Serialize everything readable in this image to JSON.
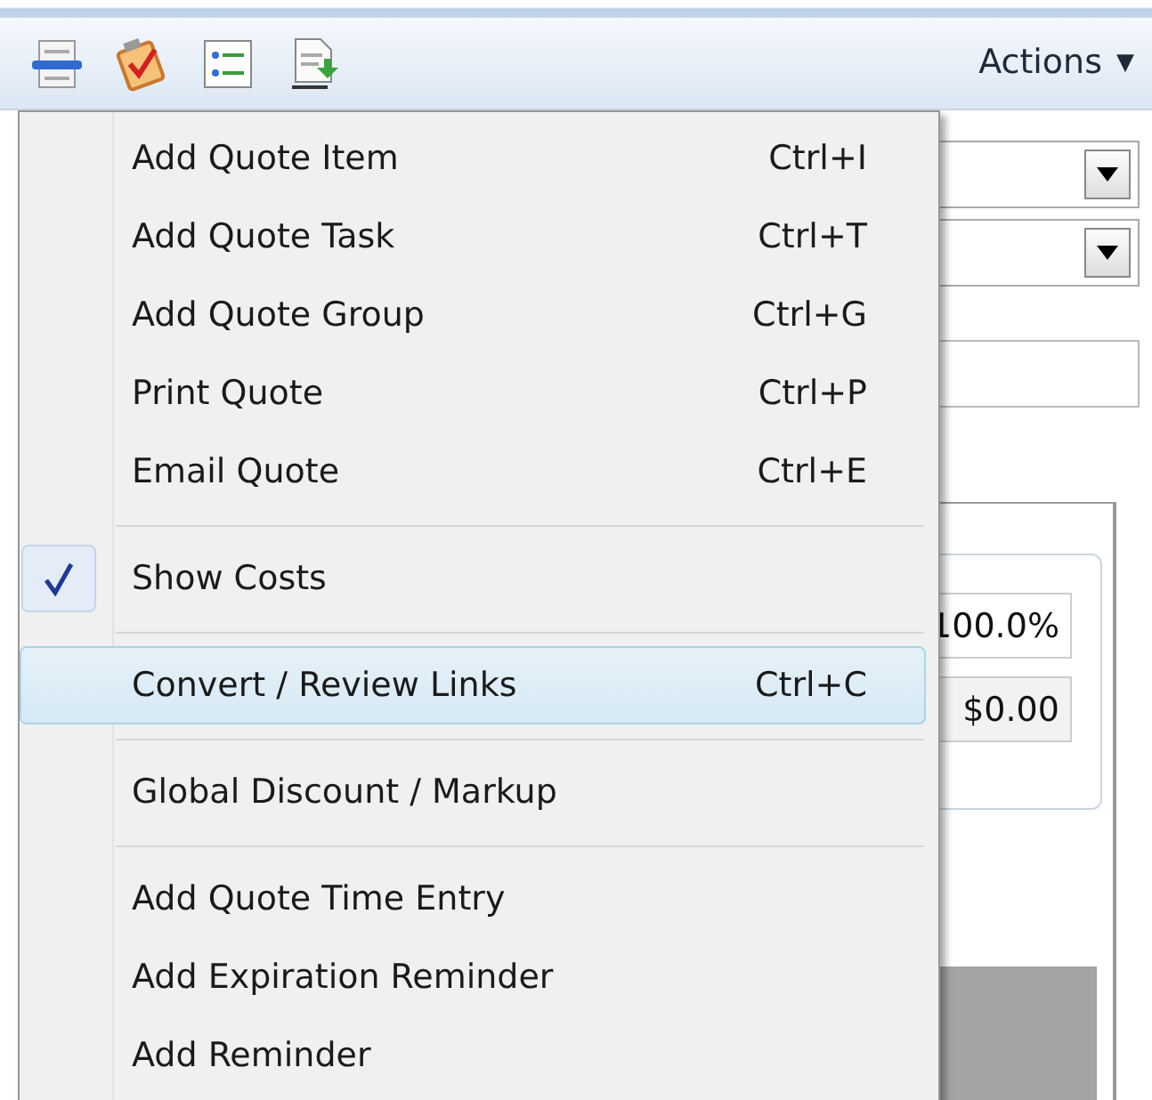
{
  "toolbar": {
    "actions_label": "Actions",
    "actions_caret": "▼"
  },
  "menu": {
    "items": [
      {
        "kind": "command",
        "label": "Add Quote Item",
        "shortcut": "Ctrl+I",
        "checked": false,
        "selected": false
      },
      {
        "kind": "command",
        "label": "Add Quote Task",
        "shortcut": "Ctrl+T",
        "checked": false,
        "selected": false
      },
      {
        "kind": "command",
        "label": "Add Quote Group",
        "shortcut": "Ctrl+G",
        "checked": false,
        "selected": false
      },
      {
        "kind": "command",
        "label": "Print Quote",
        "shortcut": "Ctrl+P",
        "checked": false,
        "selected": false
      },
      {
        "kind": "command",
        "label": "Email Quote",
        "shortcut": "Ctrl+E",
        "checked": false,
        "selected": false
      },
      {
        "kind": "separator"
      },
      {
        "kind": "command",
        "label": "Show Costs",
        "checked": true,
        "selected": false
      },
      {
        "kind": "separator"
      },
      {
        "kind": "command",
        "label": "Convert / Review Links",
        "shortcut": "Ctrl+C",
        "checked": false,
        "selected": true
      },
      {
        "kind": "separator"
      },
      {
        "kind": "command",
        "label": "Global Discount / Markup",
        "checked": false,
        "selected": false
      },
      {
        "kind": "separator"
      },
      {
        "kind": "command",
        "label": "Add Quote Time Entry",
        "checked": false,
        "selected": false
      },
      {
        "kind": "command",
        "label": "Add Expiration Reminder",
        "checked": false,
        "selected": false
      },
      {
        "kind": "command",
        "label": "Add Reminder",
        "checked": false,
        "selected": false
      }
    ]
  },
  "form": {
    "percent_value": "100.0%",
    "amount_value": "$0.00"
  }
}
